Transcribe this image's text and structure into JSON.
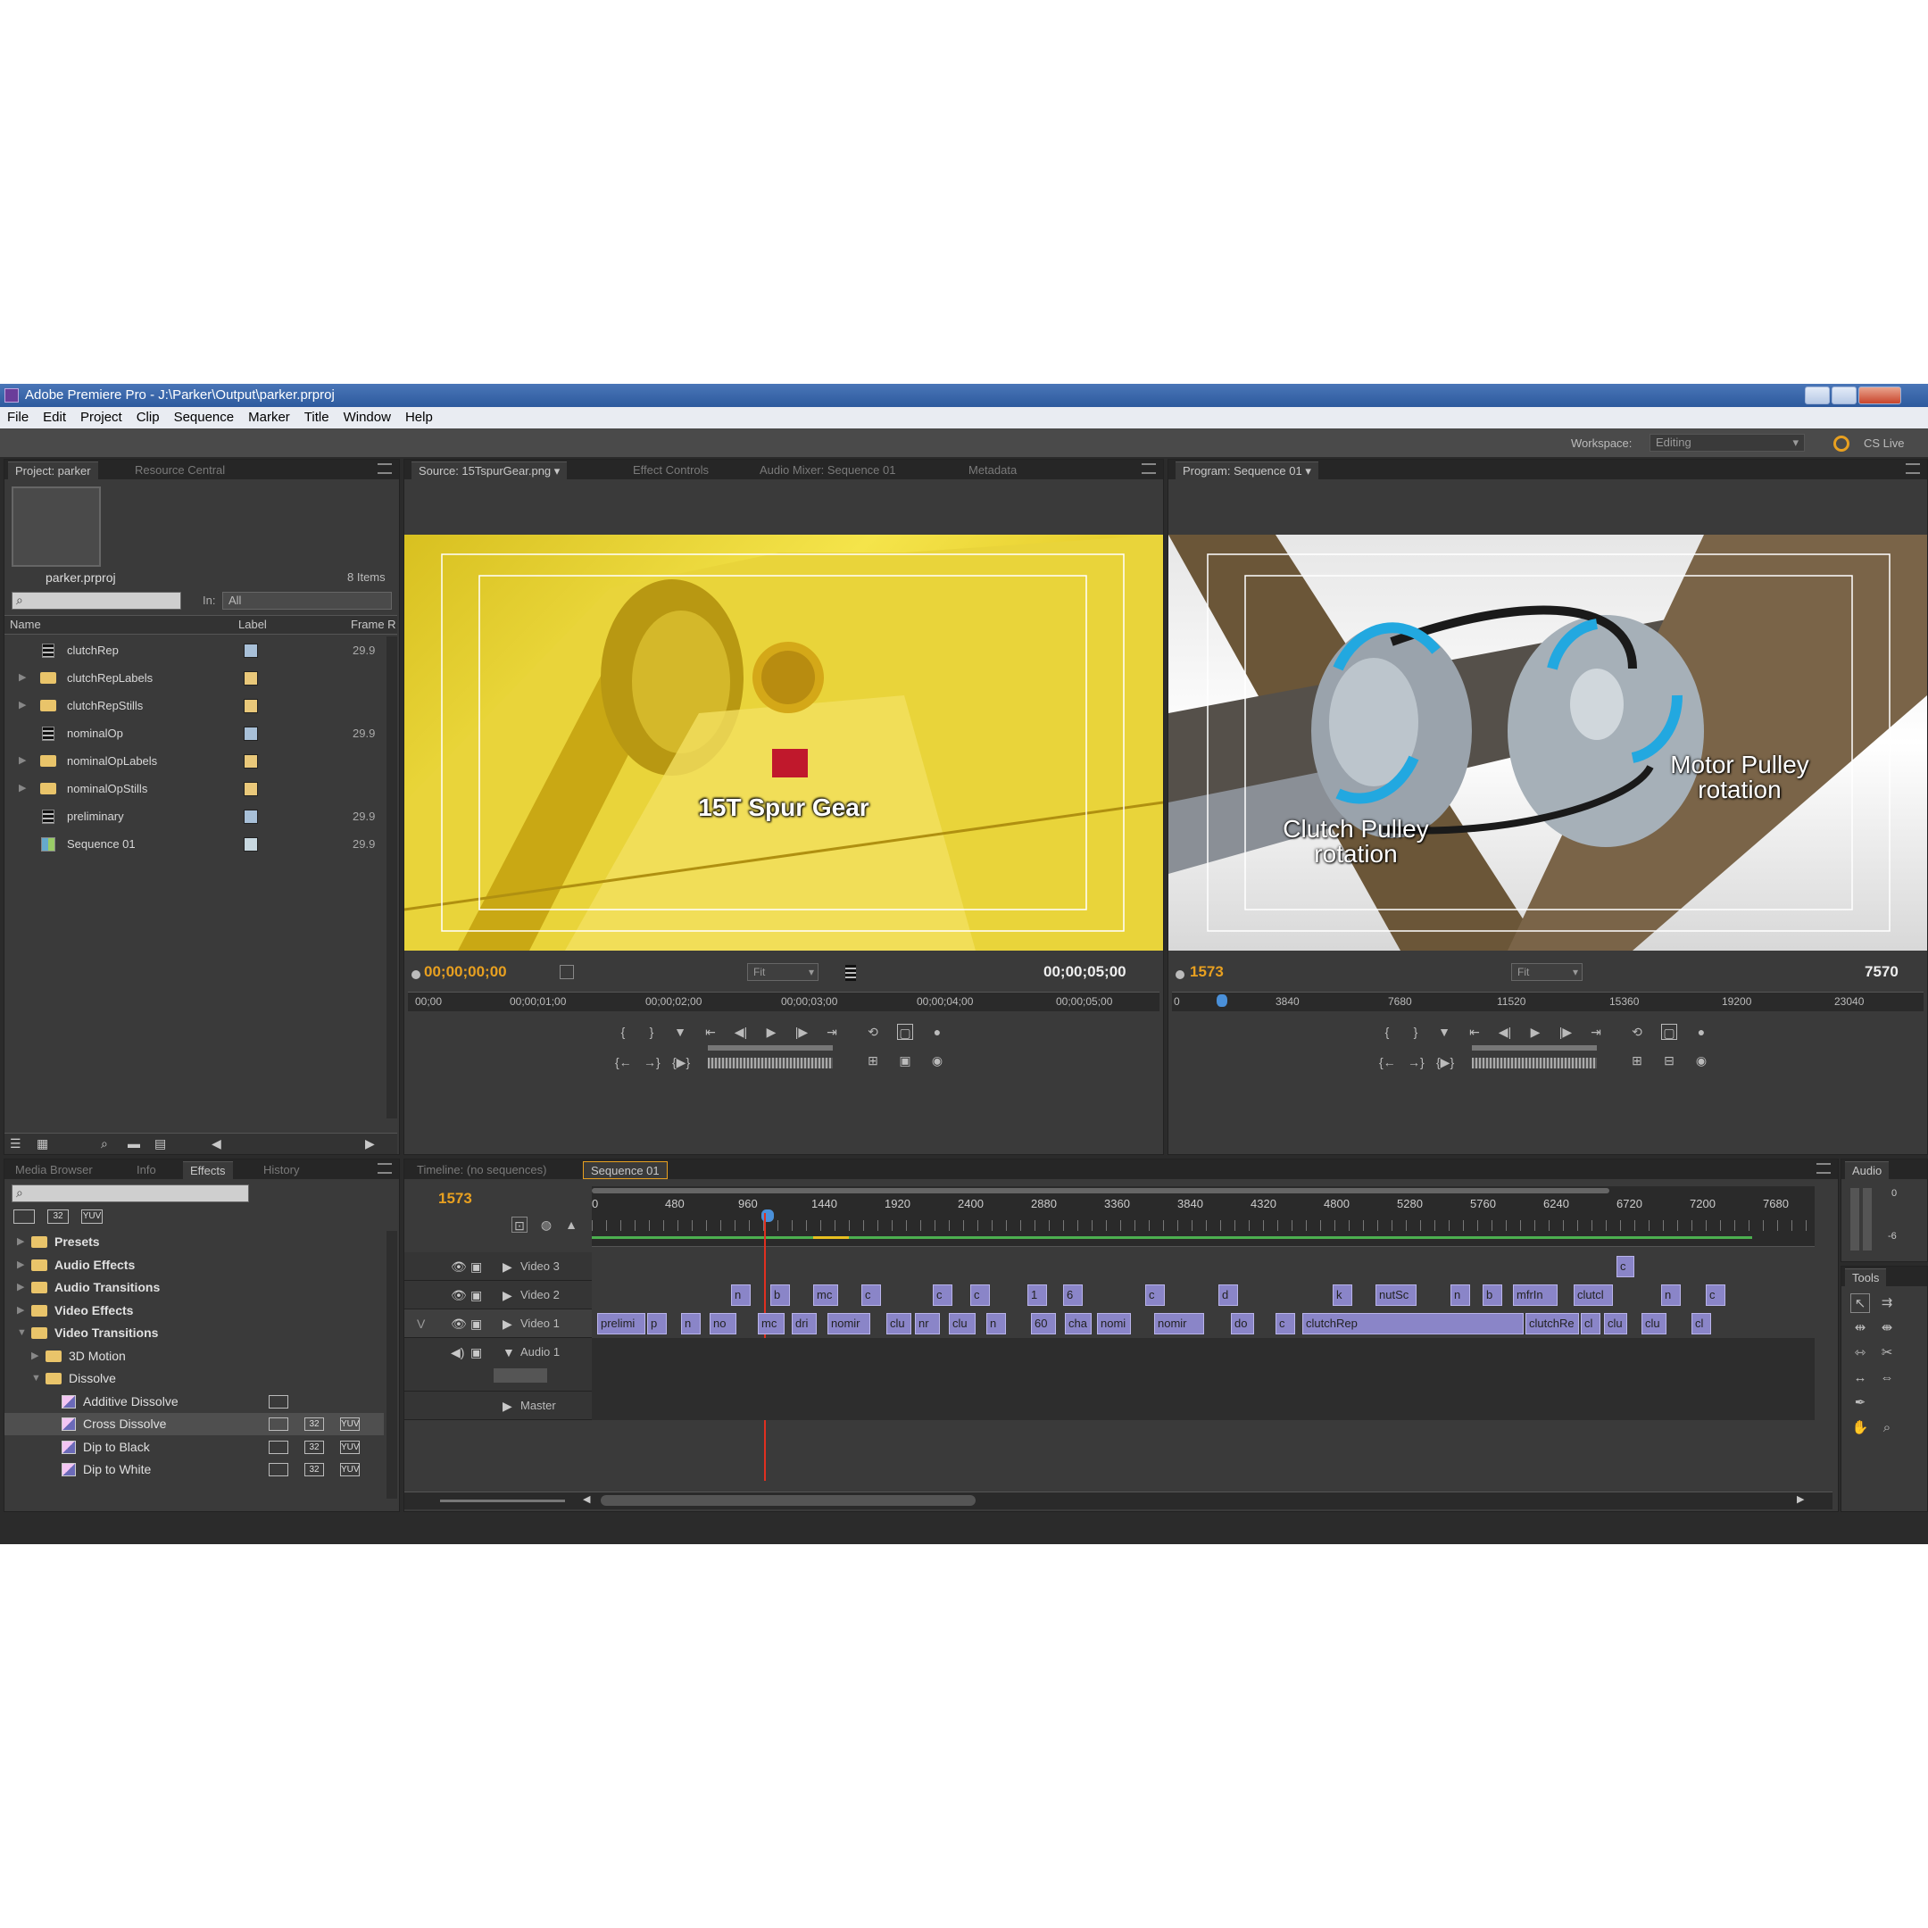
{
  "window": {
    "title": "Adobe Premiere Pro - J:\\Parker\\Output\\parker.prproj"
  },
  "menu": [
    "File",
    "Edit",
    "Project",
    "Clip",
    "Sequence",
    "Marker",
    "Title",
    "Window",
    "Help"
  ],
  "workspace": {
    "label": "Workspace:",
    "value": "Editing",
    "cslive": "CS Live"
  },
  "project": {
    "tabs": [
      "Project: parker",
      "Resource Central"
    ],
    "filename": "parker.prproj",
    "item_count": "8 Items",
    "in_label": "In:",
    "in_value": "All",
    "columns": [
      "Name",
      "Label",
      "Frame R"
    ],
    "items": [
      {
        "name": "clutchRep",
        "type": "clip",
        "label_color": "#a8c0d8",
        "fr": "29.9",
        "has_triangle": false
      },
      {
        "name": "clutchRepLabels",
        "type": "folder",
        "label_color": "#e9c87a",
        "fr": "",
        "has_triangle": true
      },
      {
        "name": "clutchRepStills",
        "type": "folder",
        "label_color": "#e9c87a",
        "fr": "",
        "has_triangle": true
      },
      {
        "name": "nominalOp",
        "type": "clip",
        "label_color": "#a8c0d8",
        "fr": "29.9",
        "has_triangle": false
      },
      {
        "name": "nominalOpLabels",
        "type": "folder",
        "label_color": "#e9c87a",
        "fr": "",
        "has_triangle": true
      },
      {
        "name": "nominalOpStills",
        "type": "folder",
        "label_color": "#e9c87a",
        "fr": "",
        "has_triangle": true
      },
      {
        "name": "preliminary",
        "type": "clip",
        "label_color": "#a8c0d8",
        "fr": "29.9",
        "has_triangle": false
      },
      {
        "name": "Sequence 01",
        "type": "sequence",
        "label_color": "#c8d8e0",
        "fr": "29.9",
        "has_triangle": false
      }
    ]
  },
  "source": {
    "tabs": [
      "Source: 15TspurGear.png",
      "Effect Controls",
      "Audio Mixer: Sequence 01",
      "Metadata"
    ],
    "caption": "15T Spur Gear",
    "timecode_in": "00;00;00;00",
    "timecode_dur": "00;00;05;00",
    "fit": "Fit",
    "ruler": [
      "00;00",
      "00;00;01;00",
      "00;00;02;00",
      "00;00;03;00",
      "00;00;04;00",
      "00;00;05;00"
    ]
  },
  "program": {
    "tab": "Program: Sequence 01",
    "caption_left_1": "Clutch Pulley",
    "caption_left_2": "rotation",
    "caption_right_1": "Motor Pulley",
    "caption_right_2": "rotation",
    "timecode_in": "1573",
    "timecode_dur": "7570",
    "fit": "Fit",
    "ruler": [
      "0",
      "3840",
      "7680",
      "11520",
      "15360",
      "19200",
      "23040"
    ]
  },
  "effects": {
    "tabs": [
      "Media Browser",
      "Info",
      "Effects",
      "History"
    ],
    "items": [
      {
        "label": "Presets",
        "kind": "folder",
        "indent": 0,
        "bold": true
      },
      {
        "label": "Audio Effects",
        "kind": "folder",
        "indent": 0,
        "bold": true
      },
      {
        "label": "Audio Transitions",
        "kind": "folder",
        "indent": 0,
        "bold": true
      },
      {
        "label": "Video Effects",
        "kind": "folder",
        "indent": 0,
        "bold": true
      },
      {
        "label": "Video Transitions",
        "kind": "folder",
        "indent": 0,
        "bold": true,
        "open": true
      },
      {
        "label": "3D Motion",
        "kind": "folder",
        "indent": 1,
        "bold": false
      },
      {
        "label": "Dissolve",
        "kind": "folder",
        "indent": 1,
        "bold": false,
        "open": true
      },
      {
        "label": "Additive Dissolve",
        "kind": "transition",
        "indent": 2,
        "badges": 1
      },
      {
        "label": "Cross Dissolve",
        "kind": "transition",
        "indent": 2,
        "badges": 3,
        "selected": true
      },
      {
        "label": "Dip to Black",
        "kind": "transition",
        "indent": 2,
        "badges": 3
      },
      {
        "label": "Dip to White",
        "kind": "transition",
        "indent": 2,
        "badges": 3
      }
    ],
    "badge_labels": [
      "32",
      "YUV"
    ]
  },
  "timeline": {
    "tabs": [
      "Timeline: (no sequences)",
      "Sequence 01"
    ],
    "timecode": "1573",
    "ruler": [
      "0",
      "480",
      "960",
      "1440",
      "1920",
      "2400",
      "2880",
      "3360",
      "3840",
      "4320",
      "4800",
      "5280",
      "5760",
      "6240",
      "6720",
      "7200",
      "7680"
    ],
    "tracks": [
      "Video 3",
      "Video 2",
      "Video 1",
      "Audio 1",
      "Master"
    ],
    "track_v_label": "V",
    "video3_clips": [
      "c"
    ],
    "video2_clips": [
      "n",
      "b",
      "mc",
      "c",
      "c",
      "c",
      "1",
      "6",
      "c",
      "d",
      "k",
      "nutSc",
      "n",
      "b",
      "mfrIn",
      "clutcl",
      "n",
      "c"
    ],
    "video1_clips": [
      "prelimi",
      "p",
      "n",
      "no",
      "mc",
      "dri",
      "nomir",
      "clu",
      "nr",
      "clu",
      "n",
      "60",
      "cha",
      "nomi",
      "nomir",
      "do",
      "c",
      "clutchRep",
      "clutchRe",
      "cl",
      "clu",
      "clu",
      "cl"
    ]
  },
  "audio_meter": {
    "label": "Audio",
    "scale_0": "0",
    "scale_6": "-6"
  },
  "tools": {
    "label": "Tools"
  }
}
